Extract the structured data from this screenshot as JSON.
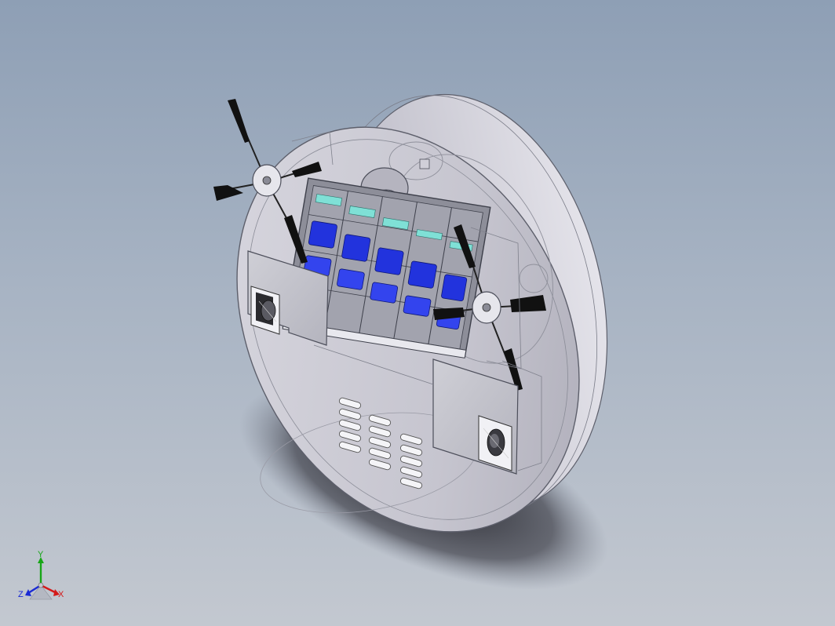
{
  "viewport": {
    "background_top": "#8e9fb5",
    "background_bottom": "#c3c8d0"
  },
  "model": {
    "body_color": "#c9c8d2",
    "edge_color": "#5d5f6b",
    "filter_accent": "#2233dd",
    "filter_highlight": "#7fe0d6",
    "brush_color": "#111111"
  },
  "triad": {
    "x_label": "X",
    "y_label": "Y",
    "z_label": "Z",
    "x_color": "#d41a1a",
    "y_color": "#17a617",
    "z_color": "#1a2ad4"
  }
}
